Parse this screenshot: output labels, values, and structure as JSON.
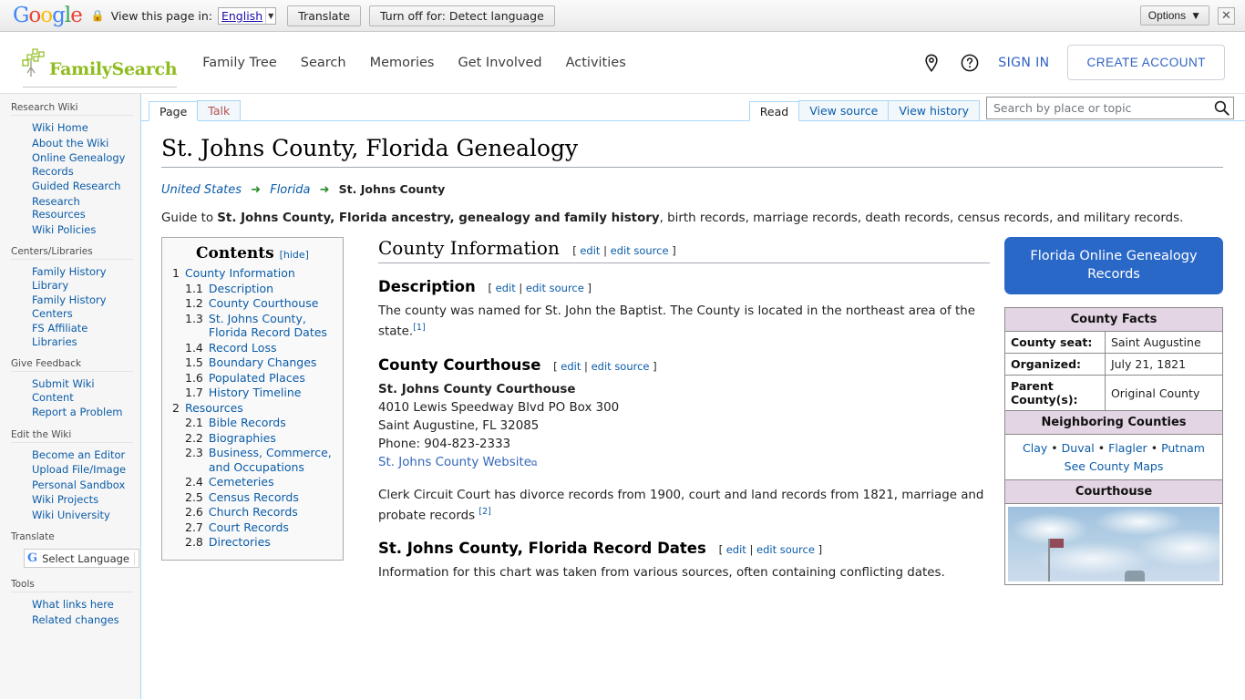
{
  "translate_bar": {
    "logo": "Google",
    "lock_icon": "lock-icon",
    "label": "View this page in:",
    "language": "English",
    "translate_button": "Translate",
    "turn_off_button": "Turn off for: Detect language",
    "options_button": "Options",
    "options_caret": "▼",
    "close_label": "✕"
  },
  "header": {
    "brand": "FamilySearch",
    "nav": [
      {
        "label": "Family Tree"
      },
      {
        "label": "Search"
      },
      {
        "label": "Memories"
      },
      {
        "label": "Get Involved"
      },
      {
        "label": "Activities"
      }
    ],
    "location_icon": "location-pin-icon",
    "help_icon": "help-circle-icon",
    "sign_in": "SIGN IN",
    "create_account": "CREATE ACCOUNT"
  },
  "sidebar": {
    "groups": [
      {
        "heading": "Research Wiki",
        "items": [
          "Wiki Home",
          "About the Wiki",
          "Online Genealogy Records",
          "Guided Research",
          "Research Resources",
          "Wiki Policies"
        ]
      },
      {
        "heading": "Centers/Libraries",
        "items": [
          "Family History Library",
          "Family History Centers",
          "FS Affiliate Libraries"
        ]
      },
      {
        "heading": "Give Feedback",
        "items": [
          "Submit Wiki Content",
          "Report a Problem"
        ]
      },
      {
        "heading": "Edit the Wiki",
        "items": [
          "Become an Editor",
          "Upload File/Image",
          "Personal Sandbox",
          "Wiki Projects",
          "Wiki University"
        ]
      }
    ],
    "translate_heading": "Translate",
    "translate_widget": "Select Language",
    "tools_heading": "Tools",
    "tools_items": [
      "What links here",
      "Related changes"
    ]
  },
  "tabs": {
    "namespace": [
      {
        "label": "Page",
        "active": true
      },
      {
        "label": "Talk",
        "active": false
      }
    ],
    "views": [
      {
        "label": "Read",
        "active": true
      },
      {
        "label": "View source",
        "active": false
      },
      {
        "label": "View history",
        "active": false
      }
    ]
  },
  "search": {
    "placeholder": "Search by place or topic",
    "value": "",
    "icon": "search-icon"
  },
  "article": {
    "title": "St. Johns County, Florida Genealogy",
    "breadcrumb": {
      "items": [
        "United States",
        "Florida"
      ],
      "arrow": "➜",
      "current": "St. Johns County"
    },
    "intro_pre": "Guide to ",
    "intro_bold": "St. Johns County, Florida ancestry, genealogy and family history",
    "intro_post": ", birth records, marriage records, death records, census records, and military records."
  },
  "toc": {
    "title": "Contents",
    "hide_label": "[hide]",
    "entries": [
      {
        "num": "1",
        "label": "County Information",
        "level": 1
      },
      {
        "num": "1.1",
        "label": "Description",
        "level": 2
      },
      {
        "num": "1.2",
        "label": "County Courthouse",
        "level": 2
      },
      {
        "num": "1.3",
        "label": "St. Johns County, Florida Record Dates",
        "level": 2
      },
      {
        "num": "1.4",
        "label": "Record Loss",
        "level": 2
      },
      {
        "num": "1.5",
        "label": "Boundary Changes",
        "level": 2
      },
      {
        "num": "1.6",
        "label": "Populated Places",
        "level": 2
      },
      {
        "num": "1.7",
        "label": "History Timeline",
        "level": 2
      },
      {
        "num": "2",
        "label": "Resources",
        "level": 1
      },
      {
        "num": "2.1",
        "label": "Bible Records",
        "level": 2
      },
      {
        "num": "2.2",
        "label": "Biographies",
        "level": 2
      },
      {
        "num": "2.3",
        "label": "Business, Commerce, and Occupations",
        "level": 2
      },
      {
        "num": "2.4",
        "label": "Cemeteries",
        "level": 2
      },
      {
        "num": "2.5",
        "label": "Census Records",
        "level": 2
      },
      {
        "num": "2.6",
        "label": "Church Records",
        "level": 2
      },
      {
        "num": "2.7",
        "label": "Court Records",
        "level": 2
      },
      {
        "num": "2.8",
        "label": "Directories",
        "level": 2
      }
    ]
  },
  "edit_links": {
    "open": "[",
    "edit": "edit",
    "pipe": "|",
    "edit_source": "edit source",
    "close": "]"
  },
  "sections": {
    "county_information": {
      "heading": "County Information"
    },
    "description": {
      "heading": "Description",
      "text": "The county was named for St. John the Baptist. The County is located in the northeast area of the state.",
      "ref": "[1]"
    },
    "courthouse": {
      "heading": "County Courthouse",
      "name": "St. Johns County Courthouse",
      "address1": "4010 Lewis Speedway Blvd PO Box 300",
      "address2": "Saint Augustine, FL 32085",
      "phone": "Phone: 904-823-2333",
      "website_link": "St. Johns County Website",
      "clerk_text": "Clerk Circuit Court has divorce records from 1900, court and land records from 1821, marriage and probate records",
      "clerk_ref": "[2]"
    },
    "record_dates": {
      "heading": "St. Johns County, Florida Record Dates",
      "text": "Information for this chart was taken from various sources, often containing conflicting dates."
    }
  },
  "rail": {
    "ogr_button": "Florida Online Genealogy Records",
    "facts_title": "County Facts",
    "facts": [
      {
        "key": "County seat:",
        "value": "Saint Augustine"
      },
      {
        "key": "Organized:",
        "value": "July 21, 1821"
      },
      {
        "key": "Parent County(s):",
        "value": "Original County"
      }
    ],
    "neighbors_title": "Neighboring Counties",
    "neighbors": [
      "Clay",
      "Duval",
      "Flagler",
      "Putnam"
    ],
    "neighbors_sep": "•",
    "county_maps_link": "See County Maps",
    "courthouse_title": "Courthouse",
    "courthouse_photo_alt": "courthouse-photo"
  },
  "colors": {
    "brand_green": "#8fbc1e",
    "link_blue": "#0b5ca8",
    "accent_blue": "#2a68c8",
    "facts_header": "#e3d5e3"
  }
}
